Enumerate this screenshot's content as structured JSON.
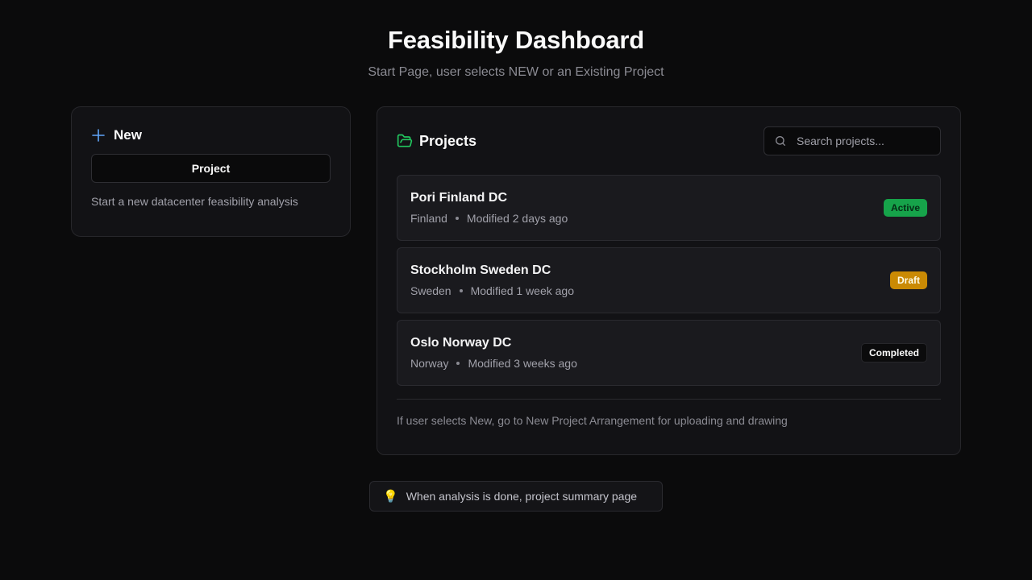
{
  "header": {
    "title": "Feasibility Dashboard",
    "subtitle": "Start Page, user selects NEW or an Existing Project"
  },
  "new_card": {
    "title": "New",
    "icon": "plus-icon",
    "button_label": "Project",
    "description": "Start a new datacenter feasibility analysis"
  },
  "projects": {
    "title": "Projects",
    "icon": "folder-open-icon",
    "search": {
      "placeholder": "Search projects...",
      "value": ""
    },
    "items": [
      {
        "name": "Pori Finland DC",
        "country": "Finland",
        "modified": "Modified 2 days ago",
        "status": "Active",
        "status_color": "#16a34a"
      },
      {
        "name": "Stockholm Sweden DC",
        "country": "Sweden",
        "modified": "Modified 1 week ago",
        "status": "Draft",
        "status_color": "#ca8a04"
      },
      {
        "name": "Oslo Norway DC",
        "country": "Norway",
        "modified": "Modified 3 weeks ago",
        "status": "Completed",
        "status_color": "#0b0b0c"
      }
    ],
    "footer_note": "If user selects New, go to New Project Arrangement for uploading and drawing"
  },
  "tip": {
    "icon": "lightbulb-icon",
    "text": "When analysis is done, project summary page"
  },
  "colors": {
    "background": "#0b0b0c",
    "card": "#121215",
    "accent_blue": "#60a5fa",
    "accent_green": "#22c55e"
  }
}
